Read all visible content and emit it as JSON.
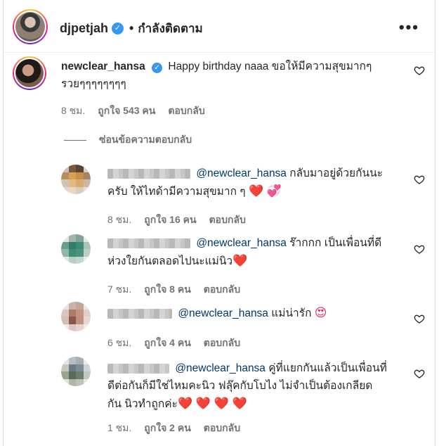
{
  "header": {
    "username": "djpetjah",
    "separator": "•",
    "follow_label": "กำลังติดตาม",
    "more_label": "•••"
  },
  "main_comment": {
    "username": "newclear_hansa",
    "text_line1": "Happy birthday naaa ขอให้มีความสุขมากๆ",
    "text_line2": "รวยๆๆๆๆๆๆๆๆ",
    "time": "8 ชม.",
    "likes": "ถูกใจ 543 คน",
    "reply_label": "ตอบกลับ"
  },
  "hide_replies_label": "ซ่อนข้อความตอบกลับ",
  "replies": [
    {
      "mention": "@newclear_hansa",
      "text_line1": "กลับมาอยู่ด้วยกันนะ",
      "text_line2": "ครับ ให้ไทด้ามีความสุขมาก ๆ",
      "hearts": "❤️ 💞",
      "time": "8 ชม.",
      "likes": "ถูกใจ 16 คน",
      "reply_label": "ตอบกลับ"
    },
    {
      "mention": "@newclear_hansa",
      "text_line1": "ร๊ากกก เป็นเพื่อนที่ดี",
      "text_line2": "ห่วงใยกันตลอดไปนะแม่นิว",
      "hearts": "❤️",
      "time": "7 ชม.",
      "likes": "ถูกใจ 8 คน",
      "reply_label": "ตอบกลับ"
    },
    {
      "mention": "@newclear_hansa",
      "text_line1": "แม่น่ารัก",
      "hearts": "😍",
      "time": "6 ชม.",
      "likes": "ถูกใจ 4 คน",
      "reply_label": "ตอบกลับ"
    },
    {
      "mention": "@newclear_hansa",
      "text_line1": "คู่ที่แยกกันแล้วเป็นเพื่อนที่",
      "text_line2": "ดีต่อกันก็มีใช่ไหมคะนิว ฟลุ๊คกับโบไง ไม่จำเป็นต้องเกลียด",
      "text_line3": "กัน นิวทำถูกค่ะ",
      "hearts": "❤️ ❤️ ❤️ ❤️",
      "time": "1 ชม.",
      "likes": "ถูกใจ 2 คน",
      "reply_label": "ตอบกลับ"
    }
  ],
  "colors": {
    "verified": "#3897f0",
    "mention": "#00376b",
    "meta": "#737373",
    "heart": "#e0245e"
  }
}
